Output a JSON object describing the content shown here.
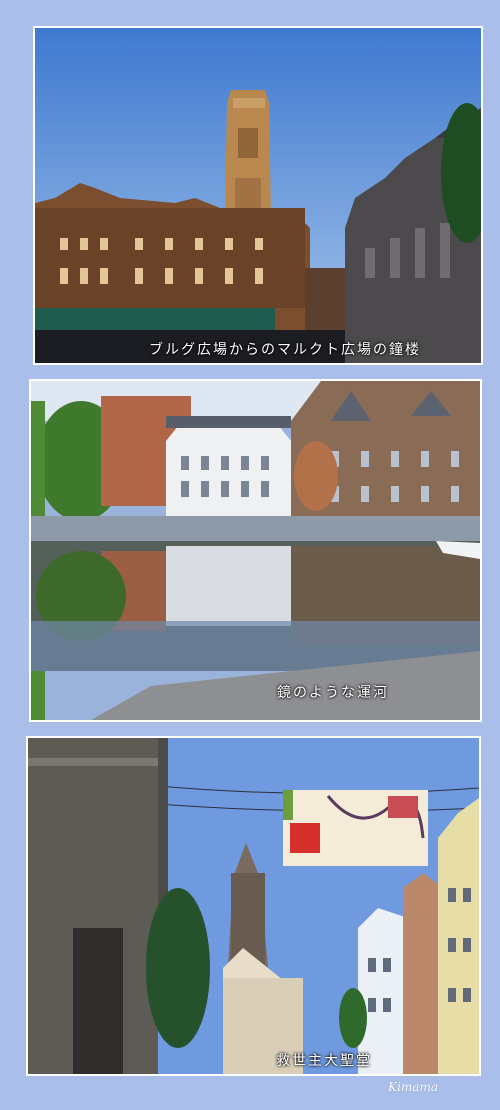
{
  "photos": [
    {
      "caption": "ブルグ広場からのマルクト広場の鐘楼"
    },
    {
      "caption": "鏡のような運河"
    },
    {
      "caption": "救世主大聖堂"
    }
  ],
  "signature": "Kimama",
  "colors": {
    "page_background": "#a9bfe9",
    "frame": "#ffffff",
    "sky": "#5d8fd6"
  }
}
